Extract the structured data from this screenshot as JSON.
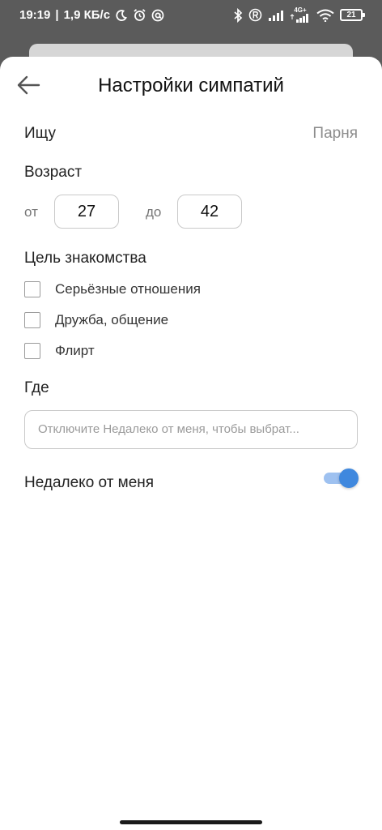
{
  "status_bar": {
    "time": "19:19",
    "speed": "1,9 КБ/с",
    "network_label": "4G+",
    "battery": "21",
    "icons": [
      "moon-icon",
      "alarm-icon",
      "at-icon",
      "bluetooth-icon",
      "registered-icon",
      "signal-icon",
      "signal-4g-icon",
      "wifi-icon",
      "battery-icon"
    ]
  },
  "header": {
    "title": "Настройки симпатий",
    "back_icon": "arrow-left-icon"
  },
  "seek": {
    "label": "Ищу",
    "value": "Парня"
  },
  "age": {
    "label": "Возраст",
    "from_label": "от",
    "from_value": "27",
    "to_label": "до",
    "to_value": "42"
  },
  "goal": {
    "label": "Цель знакомства",
    "options": [
      {
        "label": "Серьёзные отношения",
        "checked": false
      },
      {
        "label": "Дружба, общение",
        "checked": false
      },
      {
        "label": "Флирт",
        "checked": false
      }
    ]
  },
  "where": {
    "label": "Где",
    "placeholder": "Отключите Недалеко от меня, чтобы выбрат..."
  },
  "nearby": {
    "label": "Недалеко от меня",
    "enabled": true
  },
  "colors": {
    "accent": "#3f88de",
    "accent_track": "#9ec1f0",
    "backdrop": "#5b5b5b"
  }
}
